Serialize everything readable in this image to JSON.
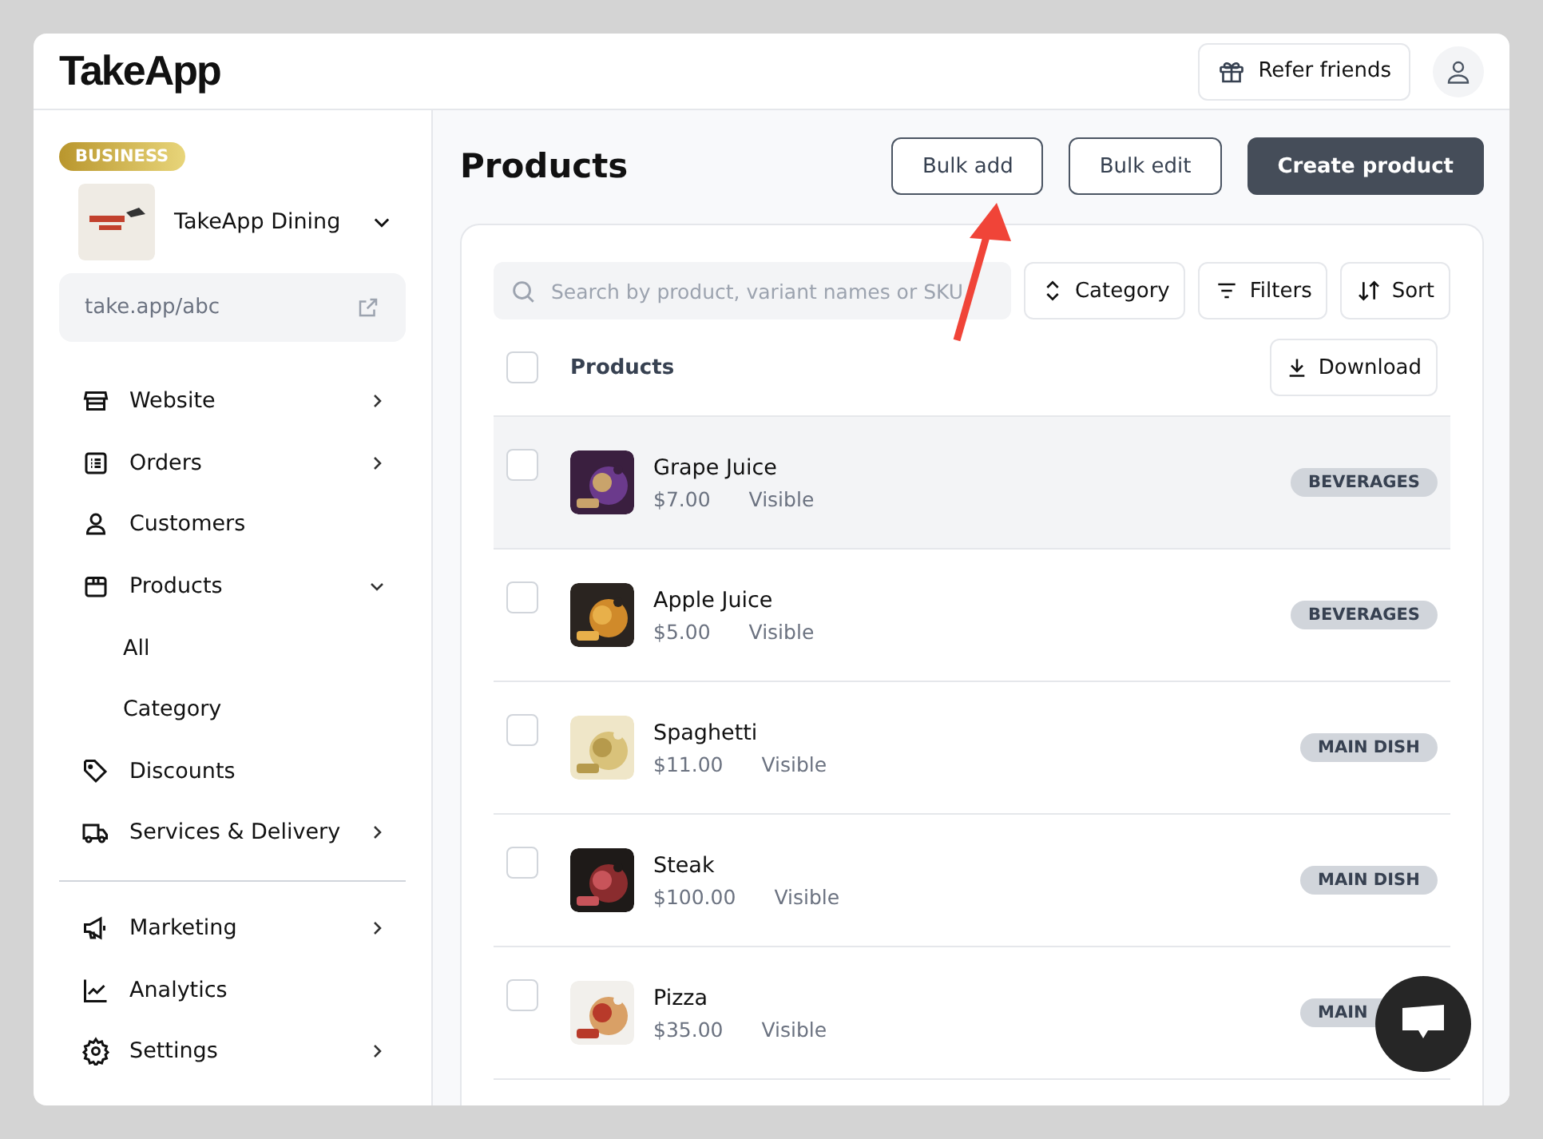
{
  "header": {
    "logo": "TakeApp",
    "refer_button": "Refer friends"
  },
  "sidebar": {
    "plan_badge": "BUSINESS",
    "store_name": "TakeApp Dining",
    "store_url": "take.app/abc",
    "items": [
      {
        "label": "Website",
        "expandable": true,
        "expanded": false
      },
      {
        "label": "Orders",
        "expandable": true,
        "expanded": false
      },
      {
        "label": "Customers",
        "expandable": false
      },
      {
        "label": "Products",
        "expandable": true,
        "expanded": true,
        "children": [
          {
            "label": "All"
          },
          {
            "label": "Category"
          }
        ]
      },
      {
        "label": "Discounts",
        "expandable": false
      },
      {
        "label": "Services & Delivery",
        "expandable": true,
        "expanded": false
      }
    ],
    "items_bottom": [
      {
        "label": "Marketing",
        "expandable": true,
        "expanded": false
      },
      {
        "label": "Analytics",
        "expandable": false
      },
      {
        "label": "Settings",
        "expandable": true,
        "expanded": false
      }
    ]
  },
  "page": {
    "title": "Products",
    "buttons": [
      {
        "label": "Bulk add",
        "kind": "outline"
      },
      {
        "label": "Bulk edit",
        "kind": "outline"
      },
      {
        "label": "Create product",
        "kind": "primary"
      }
    ]
  },
  "toolbar": {
    "search": {
      "placeholder": "Search by product, variant names or SKU"
    },
    "category": "Category",
    "filters": "Filters",
    "sort": "Sort"
  },
  "table": {
    "header": "Products",
    "header_checked": false,
    "download": "Download",
    "rows": [
      {
        "name": "Grape Juice",
        "price": "$7.00",
        "status": "Visible",
        "tag": "BEVERAGES",
        "checked": false,
        "highlighted": true
      },
      {
        "name": "Apple Juice",
        "price": "$5.00",
        "status": "Visible",
        "tag": "BEVERAGES",
        "checked": false,
        "highlighted": false
      },
      {
        "name": "Spaghetti",
        "price": "$11.00",
        "status": "Visible",
        "tag": "MAIN DISH",
        "checked": false,
        "highlighted": false
      },
      {
        "name": "Steak",
        "price": "$100.00",
        "status": "Visible",
        "tag": "MAIN DISH",
        "checked": false,
        "highlighted": false
      },
      {
        "name": "Pizza",
        "price": "$35.00",
        "status": "Visible",
        "tag": "MAIN",
        "checked": false,
        "highlighted": false
      }
    ]
  }
}
